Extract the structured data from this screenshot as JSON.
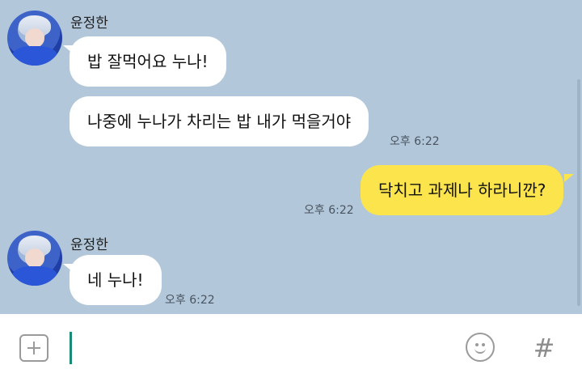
{
  "messages": [
    {
      "sender": "윤정한",
      "text": "밥 잘먹어요 누나!"
    },
    {
      "text": "나중에 누나가 차리는 밥 내가 먹을거야",
      "time": "오후 6:22"
    },
    {
      "text": "닥치고 과제나 하라니깐?",
      "time": "오후 6:22"
    },
    {
      "sender": "윤정한",
      "text": "네 누나!",
      "time": "오후 6:22"
    }
  ],
  "composer": {
    "input_value": "",
    "plus_icon": "plus-square-icon",
    "emoji_icon": "smiley-icon",
    "hashtag_symbol": "#"
  },
  "colors": {
    "chat_background": "#b2c7da",
    "incoming_bubble": "#ffffff",
    "outgoing_bubble": "#fbe44c",
    "caret": "#1a8a77"
  }
}
